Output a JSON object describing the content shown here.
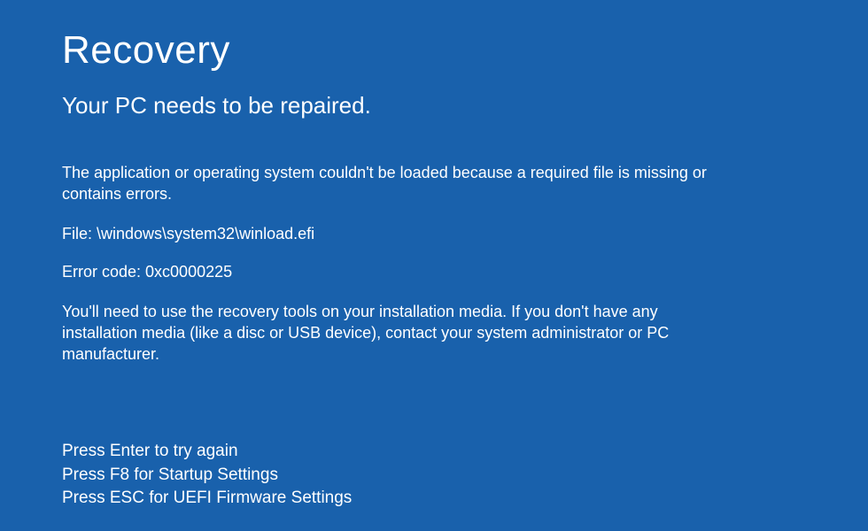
{
  "title": "Recovery",
  "subtitle": "Your PC needs to be repaired.",
  "body": {
    "intro": "The application or operating system couldn't be loaded because a required file is missing or contains errors.",
    "file_line": "File: \\windows\\system32\\winload.efi",
    "error_line": "Error code: 0xc0000225",
    "advice": "You'll need to use the recovery tools on your installation media. If you don't have any installation media (like a disc or USB device), contact your system administrator or PC manufacturer."
  },
  "instructions": {
    "line1": "Press Enter to try again",
    "line2": "Press F8 for Startup Settings",
    "line3": "Press ESC for UEFI Firmware Settings"
  }
}
